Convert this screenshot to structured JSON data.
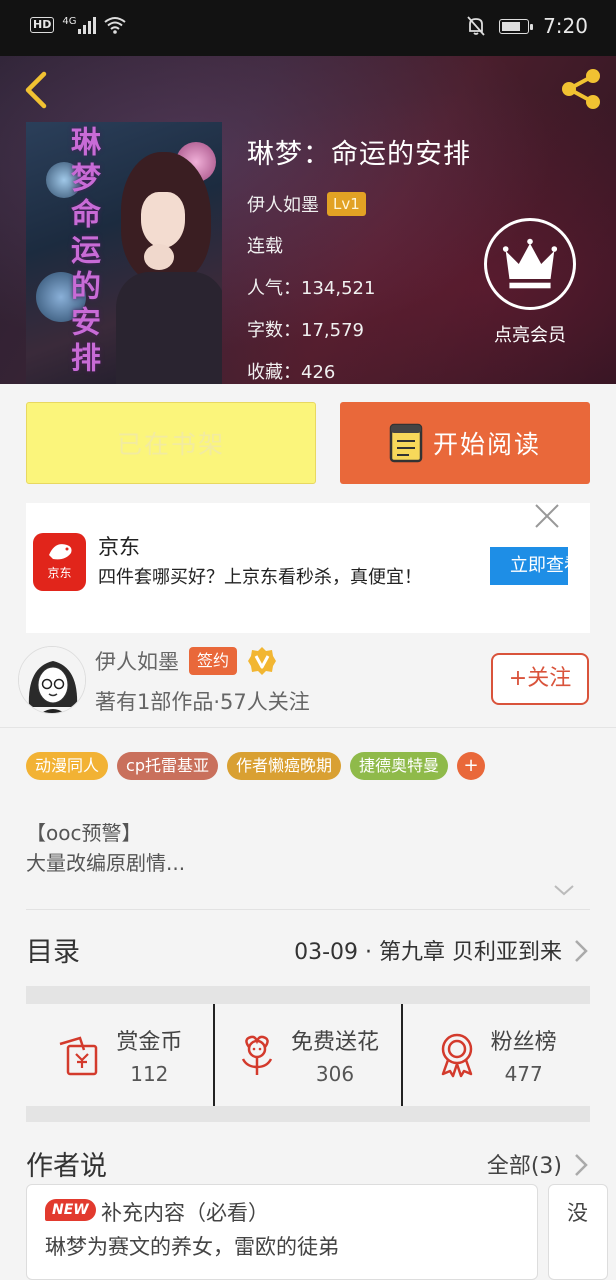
{
  "status_bar": {
    "left": [
      "HD",
      "4G"
    ],
    "time": "7:20"
  },
  "book": {
    "title": "琳梦：命运的安排",
    "author": "伊人如墨",
    "level": "Lv1",
    "status": "连载",
    "popularity": "人气：134,521",
    "word_count": "字数：17,579",
    "favorites": "收藏：426",
    "cover_text": "琳梦命运的安排",
    "vip_label": "点亮会员"
  },
  "actions": {
    "shelf_label": "已在书架",
    "read_label": "开始阅读"
  },
  "ad": {
    "logo_text": "京东",
    "name": "京东",
    "text": "四件套哪买好？上京东看秒杀，真便宜！",
    "button_label": "立即查看"
  },
  "author_card": {
    "name": "伊人如墨",
    "signed_label": "签约",
    "summary": "著有1部作品·57人关注",
    "follow_label": "+关注"
  },
  "tags": [
    {
      "label": "动漫同人",
      "color": "#f2b234"
    },
    {
      "label": "cp托雷基亚",
      "color": "#c9705c"
    },
    {
      "label": "作者懒癌晚期",
      "color": "#d9a032"
    },
    {
      "label": "捷德奥特曼",
      "color": "#8fba4a"
    }
  ],
  "tag_add_label": "+",
  "synopsis": {
    "line1": "【ooc预警】",
    "line2": "大量改编原剧情..."
  },
  "catalog": {
    "label": "目录",
    "latest": "03-09 · 第九章 贝利亚到来"
  },
  "stats": [
    {
      "label": "赏金币",
      "value": "112",
      "icon": "coin-envelope-icon"
    },
    {
      "label": "免费送花",
      "value": "306",
      "icon": "flower-icon"
    },
    {
      "label": "粉丝榜",
      "value": "477",
      "icon": "medal-icon"
    }
  ],
  "author_says": {
    "title": "作者说",
    "all_label": "全部(3)",
    "cards": [
      {
        "badge": "NEW",
        "title": "补充内容（必看）",
        "text": "琳梦为赛文的养女，雷欧的徒弟"
      },
      {
        "title": "没"
      }
    ]
  },
  "colors": {
    "accent": "#e9683a",
    "shelf_yellow": "#fbf57b",
    "follow_red": "#d9533b",
    "ad_blue": "#1e8ee6"
  }
}
